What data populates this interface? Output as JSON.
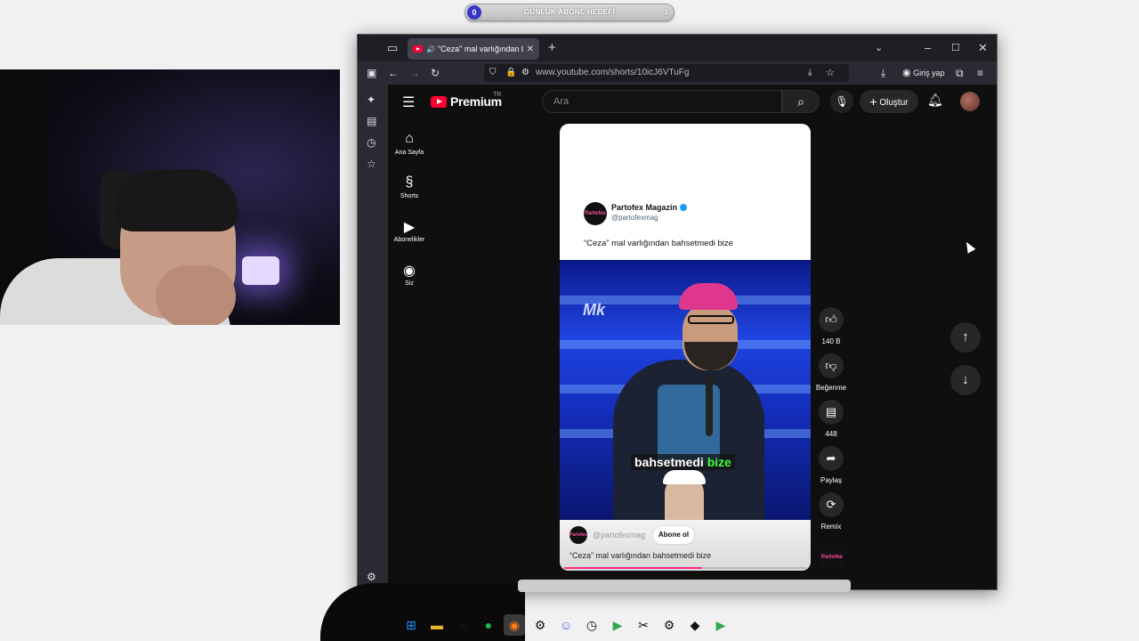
{
  "goal": {
    "current": "0",
    "label": "GÜNLÜK ABONE HEDEFİ",
    "max": "1"
  },
  "browser": {
    "tab_title": "\"Ceza\" mal varlığından bahs",
    "url": "www.youtube.com/shorts/10icJ6VTuFg",
    "login_label": "Giriş yap"
  },
  "youtube": {
    "brand": "Premium",
    "region": "TR",
    "search_placeholder": "Ara",
    "create_label": "Oluştur",
    "nav": [
      {
        "label": "Ana Sayfa",
        "icon": "home-icon"
      },
      {
        "label": "Shorts",
        "icon": "shorts-icon"
      },
      {
        "label": "Abonelikler",
        "icon": "subscriptions-icon"
      },
      {
        "label": "Siz",
        "icon": "you-icon"
      }
    ],
    "short": {
      "tweet_name": "Partofex Magazin",
      "tweet_handle": "@partofexmag",
      "tweet_text": "“Ceza” mal varlığından bahsetmedi bize",
      "avatar_text": "Partofex",
      "watermark": "Mk",
      "subtitle_word1": "bahsetmedi",
      "subtitle_word2": "bize",
      "channel_handle": "@partofexmag",
      "subscribe_label": "Abone ol",
      "title": "“Ceza” mal varlığından bahsetmedi bize",
      "progress": 0.57
    },
    "actions": {
      "likes": "140 B",
      "dislike_label": "Beğenme",
      "comments": "448",
      "share_label": "Paylaş",
      "remix_label": "Remix"
    }
  },
  "colors": {
    "youtube_red": "#ff0033",
    "subtitle_highlight": "#3cff3c",
    "progress": "#ff2d8a"
  }
}
